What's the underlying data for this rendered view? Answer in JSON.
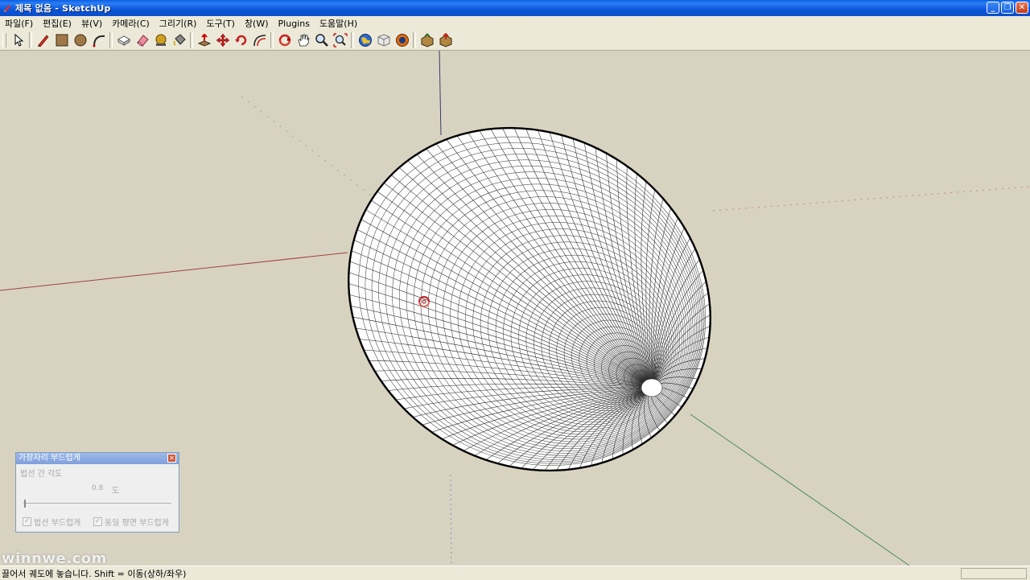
{
  "window": {
    "title": "제목 없음 - SketchUp",
    "buttons": [
      "_",
      "❐",
      "✕"
    ]
  },
  "menu": [
    "파일(F)",
    "편집(E)",
    "뷰(V)",
    "카메라(C)",
    "그리기(R)",
    "도구(T)",
    "창(W)",
    "Plugins",
    "도움말(H)"
  ],
  "toolbar": {
    "tools": [
      {
        "name": "select-tool-icon",
        "group": 1
      },
      {
        "name": "pencil-tool-icon",
        "group": 2
      },
      {
        "name": "rectangle-tool-icon",
        "group": 2
      },
      {
        "name": "circle-tool-icon",
        "group": 2
      },
      {
        "name": "arc-tool-icon",
        "group": 2
      },
      {
        "name": "make-component-icon",
        "group": 3
      },
      {
        "name": "eraser-tool-icon",
        "group": 3
      },
      {
        "name": "tape-measure-icon",
        "group": 3
      },
      {
        "name": "paint-bucket-icon",
        "group": 3
      },
      {
        "name": "push-pull-icon",
        "group": 4
      },
      {
        "name": "move-tool-icon",
        "group": 4
      },
      {
        "name": "rotate-tool-icon",
        "group": 4
      },
      {
        "name": "offset-tool-icon",
        "group": 4
      },
      {
        "name": "orbit-tool-icon",
        "group": 5
      },
      {
        "name": "pan-tool-icon",
        "group": 5
      },
      {
        "name": "zoom-tool-icon",
        "group": 5
      },
      {
        "name": "zoom-extents-icon",
        "group": 5
      },
      {
        "name": "google-earth-icon",
        "group": 6
      },
      {
        "name": "get-models-icon",
        "group": 6
      },
      {
        "name": "share-model-icon",
        "group": 6
      },
      {
        "name": "get-components-icon",
        "group": 7
      },
      {
        "name": "share-component-icon",
        "group": 7
      }
    ]
  },
  "dialog": {
    "title": "가장자리 부드럽게",
    "close": "✕",
    "angle_label": "법선 간 각도",
    "angle_value": "0.8",
    "angle_unit": "도",
    "slider_value_degrees": 0.8,
    "smooth_normals_label": "법선 부드럽게",
    "smooth_normals_checked": true,
    "smooth_coplanar_label": "동일 평면 부드럽게",
    "smooth_coplanar_checked": true
  },
  "watermark": "winnwe.com",
  "status": {
    "text": "끌어서 궤도에 놓습니다.  Shift = 이동(상하/좌우)"
  },
  "colors": {
    "titlebar": "#0a5fe0",
    "viewport_bg": "#d8d3c1",
    "red_axis": "#a04040",
    "green_axis": "#4a8a5a",
    "blue_axis": "#3a3a8a",
    "cursor": "#c0202a"
  }
}
